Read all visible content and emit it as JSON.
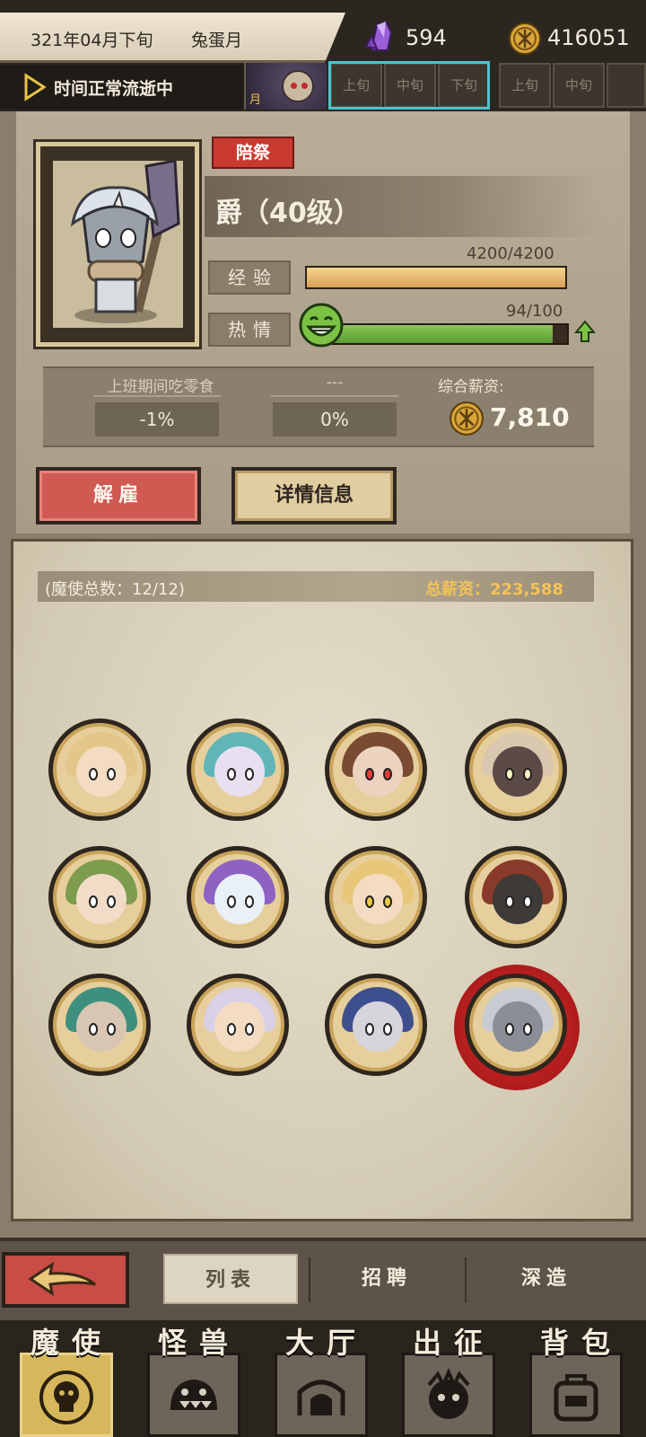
{
  "top_bar": {
    "date": "321年04月下旬",
    "month_name": "兔蛋月",
    "crystal_icon": "purple-crystal-icon",
    "crystals": "594",
    "coin_icon": "gold-coin-icon",
    "gold": "416051",
    "time_status": "时间正常流逝中",
    "month_thumb_label": "月",
    "periods": [
      "上旬",
      "中旬",
      "下旬",
      "上旬",
      "中旬"
    ]
  },
  "character": {
    "badge": "陪祭",
    "rank": "爵（40级）",
    "exp_label": "经验",
    "exp_value": "4200/4200",
    "exp_fraction": 1.0,
    "passion_label": "热情",
    "passion_value": "94/100",
    "passion_fraction": 0.94,
    "stat1_title": "上班期间吃零食",
    "stat1_value": "-1%",
    "stat2_title": "---",
    "stat2_value": "0%",
    "salary_title": "综合薪资:",
    "salary_value": "7,810",
    "fire_button": "解雇",
    "detail_button": "详情信息"
  },
  "roster": {
    "count_label": "(魔使总数：12/12)",
    "total_salary_label": "总薪资：223,588",
    "avatars": [
      {
        "name": "horned-blonde",
        "hair": "#e3c68a",
        "skin": "#f3dcc2",
        "eye": "#ffffff"
      },
      {
        "name": "teal-horned",
        "hair": "#5fb5b8",
        "skin": "#e8e0f0",
        "eye": "#ffffff"
      },
      {
        "name": "brown-red-eyes",
        "hair": "#7a4a33",
        "skin": "#ecd3c0",
        "eye": "#e23b3b"
      },
      {
        "name": "dark-skin-horned",
        "hair": "#d9c7b0",
        "skin": "#5b4a46",
        "eye": "#fff3c0"
      },
      {
        "name": "mushroom-cap",
        "hair": "#7e9c4e",
        "skin": "#f2dcc8",
        "eye": "#ffffff"
      },
      {
        "name": "purple-hood",
        "hair": "#8e62c3",
        "skin": "#e9f1f7",
        "eye": "#ffffff"
      },
      {
        "name": "witch-hat",
        "hair": "#e8c77a",
        "skin": "#f3dcc2",
        "eye": "#e9c94a"
      },
      {
        "name": "dark-eyeball",
        "hair": "#8a3a2a",
        "skin": "#3d3a38",
        "eye": "#ffffff"
      },
      {
        "name": "mermaid",
        "hair": "#3f8f7e",
        "skin": "#d9c6b2",
        "eye": "#ffffff"
      },
      {
        "name": "pumpkin-hat",
        "hair": "#d8d0e6",
        "skin": "#f3dcc2",
        "eye": "#ffffff"
      },
      {
        "name": "blue-hood-eye",
        "hair": "#3e4f8e",
        "skin": "#d7d4dc",
        "eye": "#ffffff"
      },
      {
        "name": "masked-beast-selected",
        "hair": "#c8ccd2",
        "skin": "#8b8e96",
        "eye": "#ffffff"
      }
    ]
  },
  "subnav": {
    "back_icon": "back-arrow-icon",
    "tabs": [
      "列表",
      "招聘",
      "深造"
    ]
  },
  "mainnav": {
    "tabs": [
      {
        "label": "魔使",
        "icon": "skull-crest-icon"
      },
      {
        "label": "怪兽",
        "icon": "monster-face-icon"
      },
      {
        "label": "大厅",
        "icon": "hall-icon"
      },
      {
        "label": "出征",
        "icon": "battle-icon"
      },
      {
        "label": "背包",
        "icon": "backpack-icon"
      }
    ]
  },
  "colors": {
    "accent_red": "#c8392f",
    "exp_bar": "#e8b86a",
    "passion_bar": "#6fae3f",
    "gold_text": "#f3c25a",
    "period_highlight": "#4fc2d0"
  }
}
